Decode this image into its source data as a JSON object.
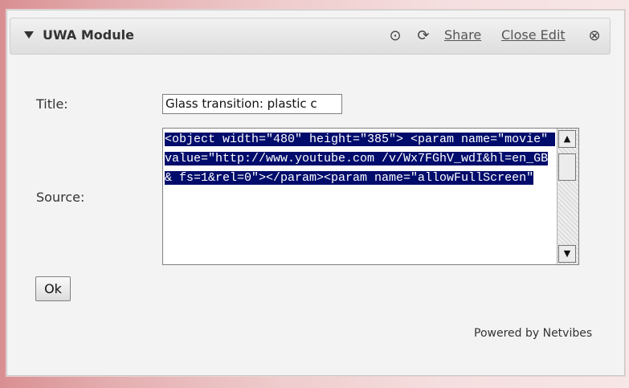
{
  "module": {
    "title": "UWA Module",
    "share_label": "Share",
    "close_edit_label": "Close Edit",
    "icons": [
      "collapse-icon",
      "down-circle-icon",
      "refresh-icon",
      "close-circle-icon"
    ]
  },
  "form": {
    "title_label": "Title:",
    "title_value": "Glass transition: plastic c",
    "source_label": "Source:",
    "source_value": "<object width=\"480\" height=\"385\"> <param name=\"movie\" value=\"http://www.youtube.com /v/Wx7FGhV_wdI&hl=en_GB& fs=1&rel=0\"></param><param name=\"allowFullScreen\"",
    "ok_label": "Ok"
  },
  "footer": {
    "powered_by": "Powered by Netvibes"
  },
  "colors": {
    "selection_bg": "#000c6b",
    "header_bg": "#e4e4e4",
    "panel_bg": "#f3f3f3"
  }
}
